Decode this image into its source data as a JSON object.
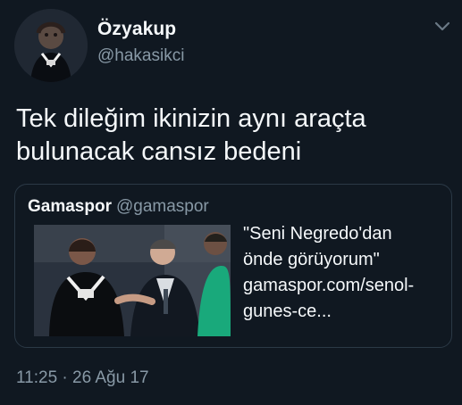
{
  "tweet": {
    "author": {
      "display_name": "Özyakup",
      "handle": "@hakasikci",
      "avatar_icon": "profile-photo"
    },
    "text": "Tek dileğim ikinizin aynı araçta\nbulunacak cansız bedeni",
    "menu_icon": "chevron-down-icon",
    "quote": {
      "author_name": "Gamaspor",
      "author_handle": "@gamaspor",
      "text_lines": [
        "\"Seni Negredo'dan",
        "önde görüyorum\"",
        "gamaspor.com/senol-",
        "gunes-ce..."
      ],
      "image_icon": "quoted-photo"
    },
    "timestamp": "11:25 · 26 Ağu 17"
  },
  "colors": {
    "background": "#101821",
    "primary_text": "#f5f8fa",
    "secondary_text": "#8899a6",
    "card_border": "#2b3946"
  }
}
